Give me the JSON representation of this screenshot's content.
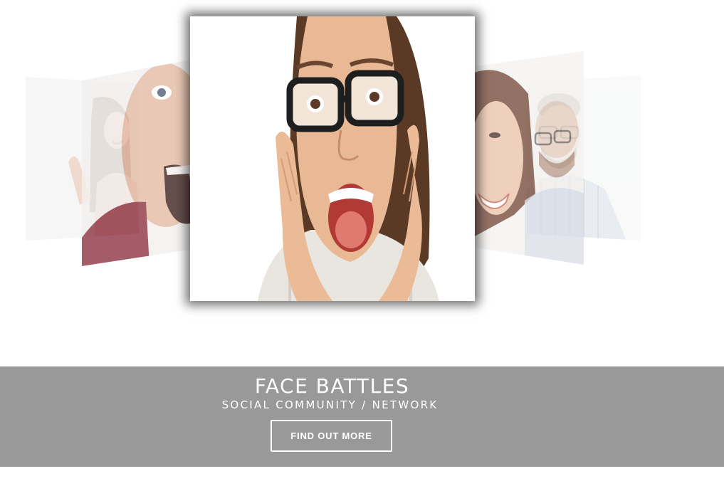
{
  "carousel": {
    "slides": [
      {
        "id": "far-left",
        "subject": "woman with raised hands, excited"
      },
      {
        "id": "left",
        "subject": "bald man shouting"
      },
      {
        "id": "center",
        "subject": "woman with glasses, hands on cheeks, screaming"
      },
      {
        "id": "right",
        "subject": "smiling woman"
      },
      {
        "id": "far-right",
        "subject": "man with glasses in striped shirt"
      }
    ],
    "active_index": 2
  },
  "banner": {
    "title": "FACE BATTLES",
    "subtitle": "SOCIAL COMMUNITY / NETWORK",
    "cta_label": "FIND OUT MORE"
  },
  "colors": {
    "banner_bg": "#999999",
    "banner_text": "#ffffff",
    "page_bg": "#ffffff"
  }
}
